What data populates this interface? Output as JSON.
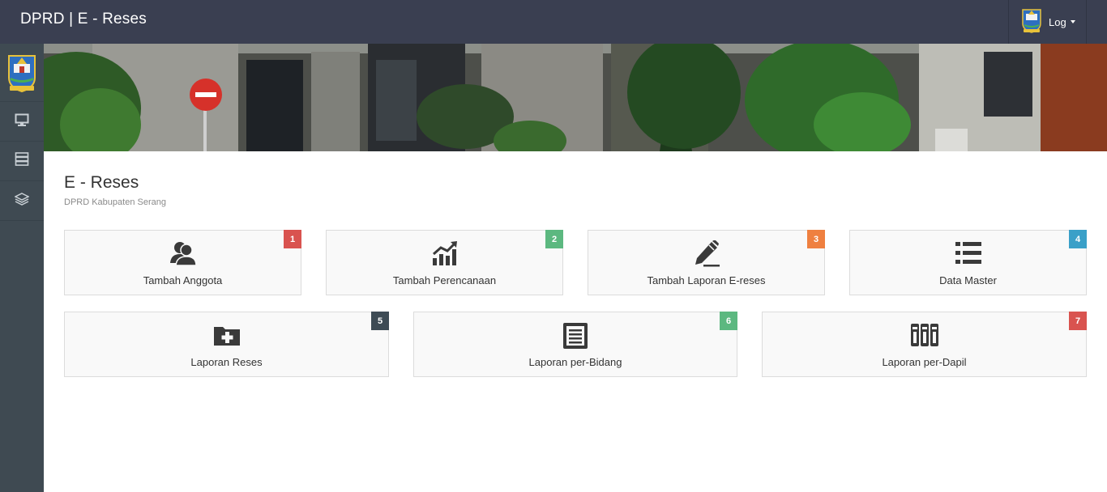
{
  "header": {
    "brand": "DPRD | E - Reses",
    "user_label": "Log"
  },
  "sidebar": {
    "items": [
      {
        "icon": "monitor-icon"
      },
      {
        "icon": "server-icon"
      },
      {
        "icon": "layers-icon"
      }
    ]
  },
  "page": {
    "title": "E - Reses",
    "subtitle": "DPRD Kabupaten Serang"
  },
  "tiles": [
    {
      "label": "Tambah Anggota",
      "badge": "1",
      "icon": "users-icon",
      "color": "#d9534f"
    },
    {
      "label": "Tambah Perencanaan",
      "badge": "2",
      "icon": "chart-icon",
      "color": "#5cb880"
    },
    {
      "label": "Tambah Laporan E-reses",
      "badge": "3",
      "icon": "pencil-icon",
      "color": "#ef8040"
    },
    {
      "label": "Data Master",
      "badge": "4",
      "icon": "list-icon",
      "color": "#3aa0c8"
    },
    {
      "label": "Laporan Reses",
      "badge": "5",
      "icon": "folder-plus-icon",
      "color": "#3e4b55"
    },
    {
      "label": "Laporan per-Bidang",
      "badge": "6",
      "icon": "document-icon",
      "color": "#5cb880"
    },
    {
      "label": "Laporan per-Dapil",
      "badge": "7",
      "icon": "binders-icon",
      "color": "#d9534f"
    }
  ]
}
